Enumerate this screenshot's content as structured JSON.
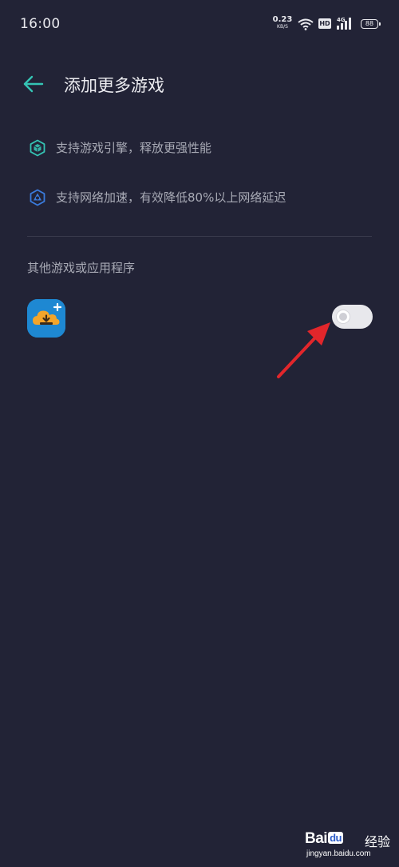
{
  "status_bar": {
    "time": "16:00",
    "net_speed_value": "0.23",
    "net_speed_unit": "KB/S",
    "hd_label": "HD",
    "network_type": "4G",
    "battery_level": "88"
  },
  "header": {
    "title": "添加更多游戏"
  },
  "features": [
    {
      "icon": "cube-icon",
      "text": "支持游戏引擎，释放更强性能"
    },
    {
      "icon": "network-boost-icon",
      "text": "支持网络加速，有效降低80%以上网络延迟"
    }
  ],
  "section": {
    "label": "其他游戏或应用程序"
  },
  "apps": [
    {
      "icon": "cloud-download-app-icon",
      "toggle_on": false
    }
  ],
  "watermark": {
    "logo_bai": "Bai",
    "logo_du": "du",
    "logo_cn": "经验",
    "url": "jingyan.baidu.com"
  },
  "colors": {
    "background": "#222336",
    "accent_teal": "#35c4b4",
    "accent_blue": "#3a7bdc",
    "annotation_red": "#e2262b"
  }
}
